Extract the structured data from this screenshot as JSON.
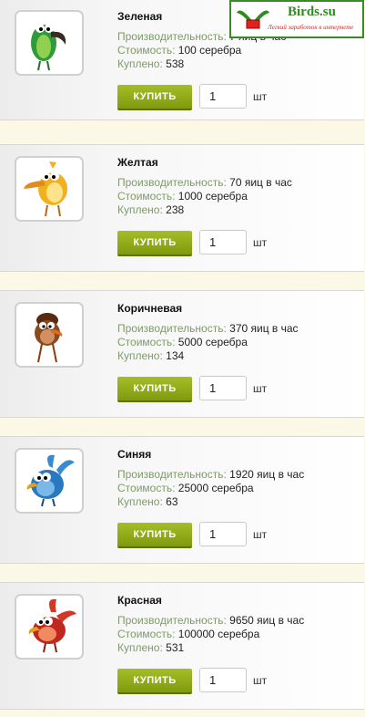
{
  "logo": {
    "name": "Birds.su",
    "slogan": "Легкий заработок в интернете",
    "colors": {
      "primary": "#2f8a22",
      "slogan": "#dd2222"
    }
  },
  "labels": {
    "productivity": "Производительность:",
    "cost": "Стоимость:",
    "bought": "Куплено:",
    "buy": "КУПИТЬ",
    "unit": "шт"
  },
  "colors": {
    "button": "#8fab1a",
    "label": "#7f9a6a",
    "background": "#fbf8e6"
  },
  "birds": [
    {
      "name": "Зеленая",
      "productivity": "7 яиц в час",
      "cost": "100 серебра",
      "bought": "538",
      "qty": "1",
      "icon": "green-bird-icon",
      "color": "#2e9a3a"
    },
    {
      "name": "Желтая",
      "productivity": "70 яиц в час",
      "cost": "1000 серебра",
      "bought": "238",
      "qty": "1",
      "icon": "yellow-bird-icon",
      "color": "#f0b020"
    },
    {
      "name": "Коричневая",
      "productivity": "370 яиц в час",
      "cost": "5000 серебра",
      "bought": "134",
      "qty": "1",
      "icon": "brown-bird-icon",
      "color": "#8a4a20"
    },
    {
      "name": "Синяя",
      "productivity": "1920 яиц в час",
      "cost": "25000 серебра",
      "bought": "63",
      "qty": "1",
      "icon": "blue-bird-icon",
      "color": "#2a78c0"
    },
    {
      "name": "Красная",
      "productivity": "9650 яиц в час",
      "cost": "100000 серебра",
      "bought": "531",
      "qty": "1",
      "icon": "red-bird-icon",
      "color": "#c0281e"
    }
  ]
}
